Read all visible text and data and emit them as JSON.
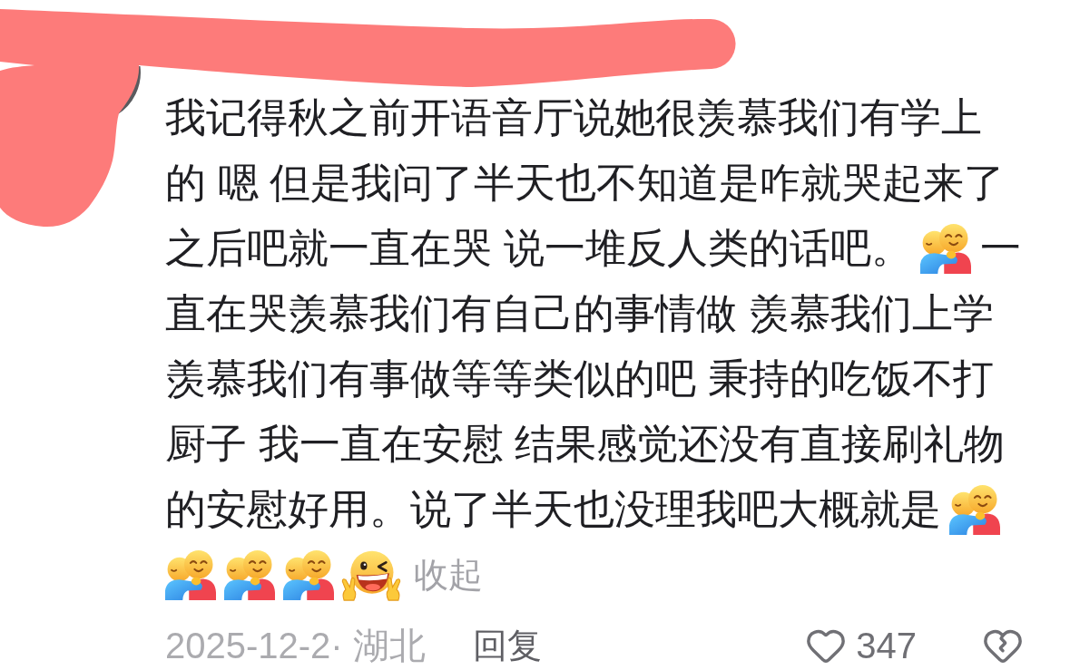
{
  "comment": {
    "lines": [
      {
        "segments": [
          {
            "kind": "text",
            "text": "我记得秋之前开语音厅说她很羡慕我们有学上"
          }
        ]
      },
      {
        "segments": [
          {
            "kind": "text",
            "text": "的 嗯 但是我问了半天也不知道是咋就哭起来了"
          }
        ]
      },
      {
        "segments": [
          {
            "kind": "text",
            "text": "之后吧就一直在哭 说一堆反人类的话吧。"
          },
          {
            "kind": "hug"
          },
          {
            "kind": "text",
            "text": "一"
          }
        ]
      },
      {
        "segments": [
          {
            "kind": "text",
            "text": "直在哭羡慕我们有自己的事情做 羡慕我们上学"
          }
        ]
      },
      {
        "segments": [
          {
            "kind": "text",
            "text": "羡慕我们有事做等等类似的吧 秉持的吃饭不打"
          }
        ]
      },
      {
        "segments": [
          {
            "kind": "text",
            "text": "厨子 我一直在安慰 结果感觉还没有直接刷礼物"
          }
        ]
      },
      {
        "segments": [
          {
            "kind": "text",
            "text": "的安慰好用。说了半天也没理我吧大概就是"
          },
          {
            "kind": "hug"
          }
        ]
      },
      {
        "segments": [
          {
            "kind": "hug"
          },
          {
            "kind": "hug"
          },
          {
            "kind": "hug"
          },
          {
            "kind": "grin"
          },
          {
            "kind": "link",
            "text": "收起"
          }
        ]
      }
    ]
  },
  "footer": {
    "meta": "2025-12-2· 湖北",
    "reply": "回复",
    "likes": "347",
    "liked": false,
    "disliked": false
  }
}
